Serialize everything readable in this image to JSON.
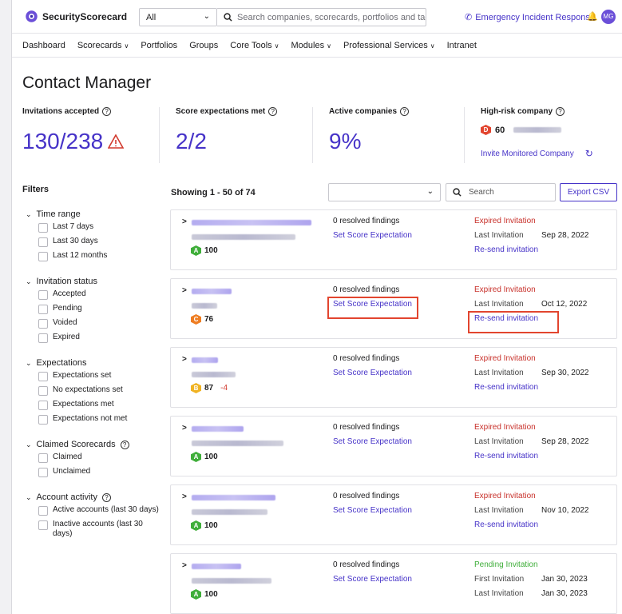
{
  "header": {
    "logo_text": "SecurityScorecard",
    "scope_value": "All",
    "search_placeholder": "Search companies, scorecards, portfolios and tags...",
    "emergency_label": "Emergency Incident Response",
    "avatar_initials": "MG"
  },
  "nav": [
    {
      "label": "Dashboard",
      "dropdown": false
    },
    {
      "label": "Scorecards",
      "dropdown": true
    },
    {
      "label": "Portfolios",
      "dropdown": false
    },
    {
      "label": "Groups",
      "dropdown": false
    },
    {
      "label": "Core Tools",
      "dropdown": true
    },
    {
      "label": "Modules",
      "dropdown": true
    },
    {
      "label": "Professional Services",
      "dropdown": true
    },
    {
      "label": "Intranet",
      "dropdown": false
    }
  ],
  "page_title": "Contact Manager",
  "stats": {
    "invitations_label": "Invitations accepted",
    "invitations_value": "130/238",
    "expectations_label": "Score expectations met",
    "expectations_value": "2/2",
    "active_label": "Active companies",
    "active_value": "9%",
    "highrisk_label": "High-risk company",
    "highrisk_grade": "D",
    "highrisk_score": "60",
    "invite_label": "Invite Monitored Company"
  },
  "filters": {
    "title": "Filters",
    "groups": [
      {
        "label": "Time range",
        "help": false,
        "options": [
          "Last 7 days",
          "Last 30 days",
          "Last 12 months"
        ]
      },
      {
        "label": "Invitation status",
        "help": false,
        "options": [
          "Accepted",
          "Pending",
          "Voided",
          "Expired"
        ]
      },
      {
        "label": "Expectations",
        "help": false,
        "options": [
          "Expectations set",
          "No expectations set",
          "Expectations met",
          "Expectations not met"
        ]
      },
      {
        "label": "Claimed Scorecards",
        "help": true,
        "options": [
          "Claimed",
          "Unclaimed"
        ]
      },
      {
        "label": "Account activity",
        "help": true,
        "options": [
          "Active accounts (last 30 days)",
          "Inactive accounts (last 30 days)"
        ]
      }
    ]
  },
  "list": {
    "showing": "Showing 1 - 50 of 74",
    "search_placeholder": "Search",
    "export_label": "Export CSV",
    "cards": [
      {
        "grade": "A",
        "grade_color": "#3fae3a",
        "score": "100",
        "delta": "",
        "findings": "0 resolved findings",
        "expectation_link": "Set Score Expectation",
        "status": "Expired Invitation",
        "status_color": "#c8312b",
        "line2_label": "Last Invitation",
        "line2_date": "Sep 28, 2022",
        "line3_label": "Re-send invitation",
        "line3_date": ""
      },
      {
        "grade": "C",
        "grade_color": "#ee7d22",
        "score": "76",
        "delta": "",
        "findings": "0 resolved findings",
        "expectation_link": "Set Score Expectation",
        "status": "Expired Invitation",
        "status_color": "#c8312b",
        "line2_label": "Last Invitation",
        "line2_date": "Oct 12, 2022",
        "line3_label": "Re-send invitation",
        "line3_date": ""
      },
      {
        "grade": "B",
        "grade_color": "#f0b323",
        "score": "87",
        "delta": "-4",
        "findings": "0 resolved findings",
        "expectation_link": "Set Score Expectation",
        "status": "Expired Invitation",
        "status_color": "#c8312b",
        "line2_label": "Last Invitation",
        "line2_date": "Sep 30, 2022",
        "line3_label": "Re-send invitation",
        "line3_date": ""
      },
      {
        "grade": "A",
        "grade_color": "#3fae3a",
        "score": "100",
        "delta": "",
        "findings": "0 resolved findings",
        "expectation_link": "Set Score Expectation",
        "status": "Expired Invitation",
        "status_color": "#c8312b",
        "line2_label": "Last Invitation",
        "line2_date": "Sep 28, 2022",
        "line3_label": "Re-send invitation",
        "line3_date": ""
      },
      {
        "grade": "A",
        "grade_color": "#3fae3a",
        "score": "100",
        "delta": "",
        "findings": "0 resolved findings",
        "expectation_link": "Set Score Expectation",
        "status": "Expired Invitation",
        "status_color": "#c8312b",
        "line2_label": "Last Invitation",
        "line2_date": "Nov 10, 2022",
        "line3_label": "Re-send invitation",
        "line3_date": ""
      },
      {
        "grade": "A",
        "grade_color": "#3fae3a",
        "score": "100",
        "delta": "",
        "findings": "0 resolved findings",
        "expectation_link": "Set Score Expectation",
        "status": "Pending Invitation",
        "status_color": "#3fae3a",
        "line2_label": "First Invitation",
        "line2_date": "Jan 30, 2023",
        "line3_label": "Last Invitation",
        "line3_date": "Jan 30, 2023"
      }
    ]
  },
  "colors": {
    "accent": "#4633c8",
    "highlight": "#e2452f",
    "highrisk": "#e2452f",
    "warning": "#d23b2f"
  }
}
